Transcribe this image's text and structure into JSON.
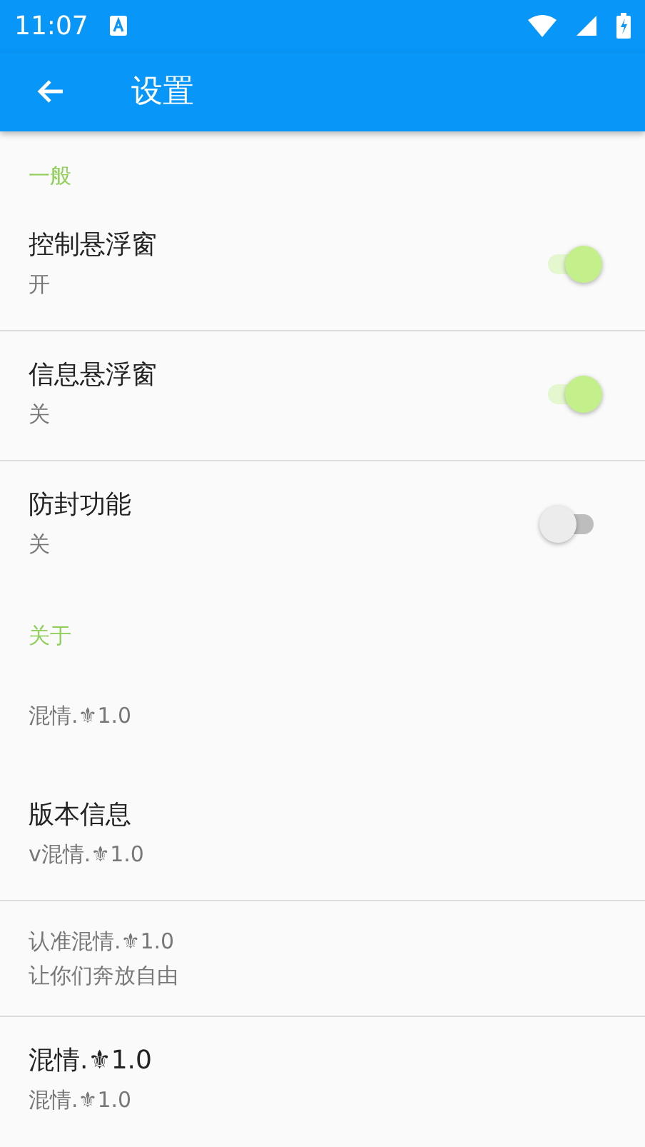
{
  "status_bar": {
    "time": "11:07"
  },
  "toolbar": {
    "title": "设置"
  },
  "sections": [
    {
      "header": "一般",
      "items": [
        {
          "kind": "switch",
          "title": "控制悬浮窗",
          "summary": "开",
          "on": true,
          "divider_below": true
        },
        {
          "kind": "switch",
          "title": "信息悬浮窗",
          "summary": "关",
          "on": true,
          "divider_below": true
        },
        {
          "kind": "switch",
          "title": "防封功能",
          "summary": "关",
          "on": false,
          "divider_below": false
        }
      ]
    },
    {
      "header": "关于",
      "items": [
        {
          "kind": "summary_only",
          "summary": "混情.⚜1.0",
          "divider_below": false
        },
        {
          "kind": "text",
          "title": "版本信息",
          "summary": "v混情.⚜1.0",
          "divider_below": true
        },
        {
          "kind": "summary_only",
          "summary": "认准混情.⚜1.0\n让你们奔放自由",
          "divider_below": true
        },
        {
          "kind": "text",
          "title": "混情.⚜1.0",
          "summary": "混情.⚜1.0",
          "divider_below": false
        }
      ]
    }
  ]
}
